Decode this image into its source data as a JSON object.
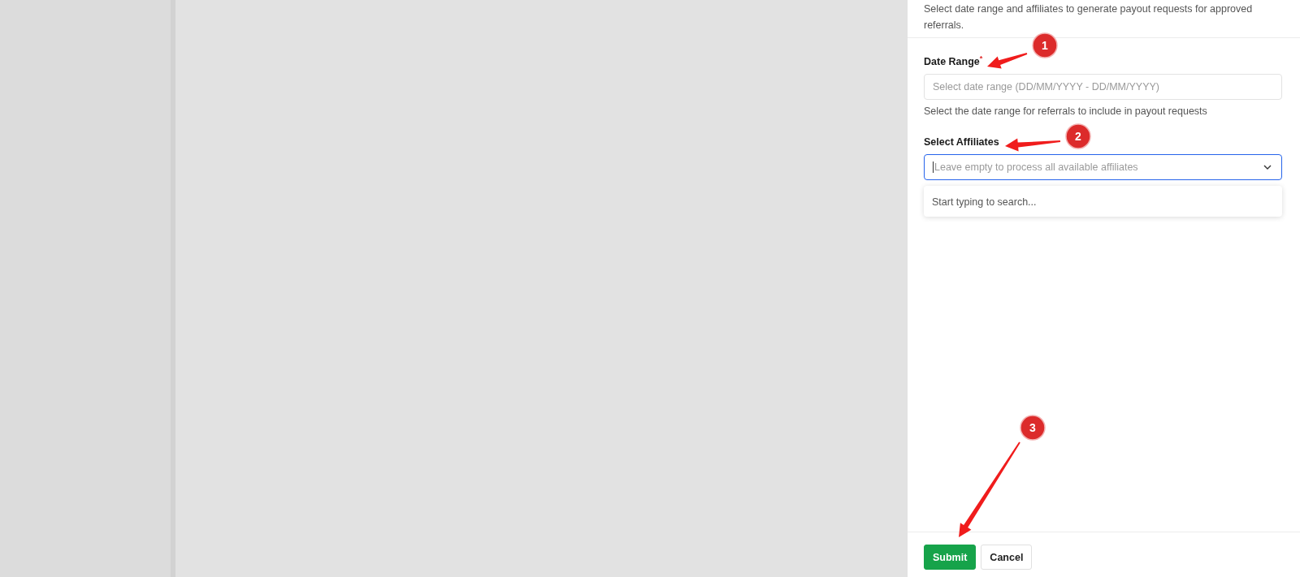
{
  "panel": {
    "description": "Select date range and affiliates to generate payout requests for approved referrals.",
    "fields": [
      {
        "kind": "date",
        "label": "Date Range",
        "required_mark": "*",
        "focused": false,
        "placeholder": "Select date range (DD/MM/YYYY - DD/MM/YYYY)",
        "help": "Select the date range for referrals to include in payout requests"
      },
      {
        "kind": "select",
        "label": "Select Affiliates",
        "focused": true,
        "placeholder": "Leave empty to process all available affiliates",
        "dropdown_message": "Start typing to search..."
      }
    ],
    "buttons": [
      {
        "label": "Submit",
        "kind": "primary"
      },
      {
        "label": "Cancel",
        "kind": "secondary"
      }
    ]
  },
  "annotations": [
    {
      "number": "1"
    },
    {
      "number": "2"
    },
    {
      "number": "3"
    }
  ]
}
